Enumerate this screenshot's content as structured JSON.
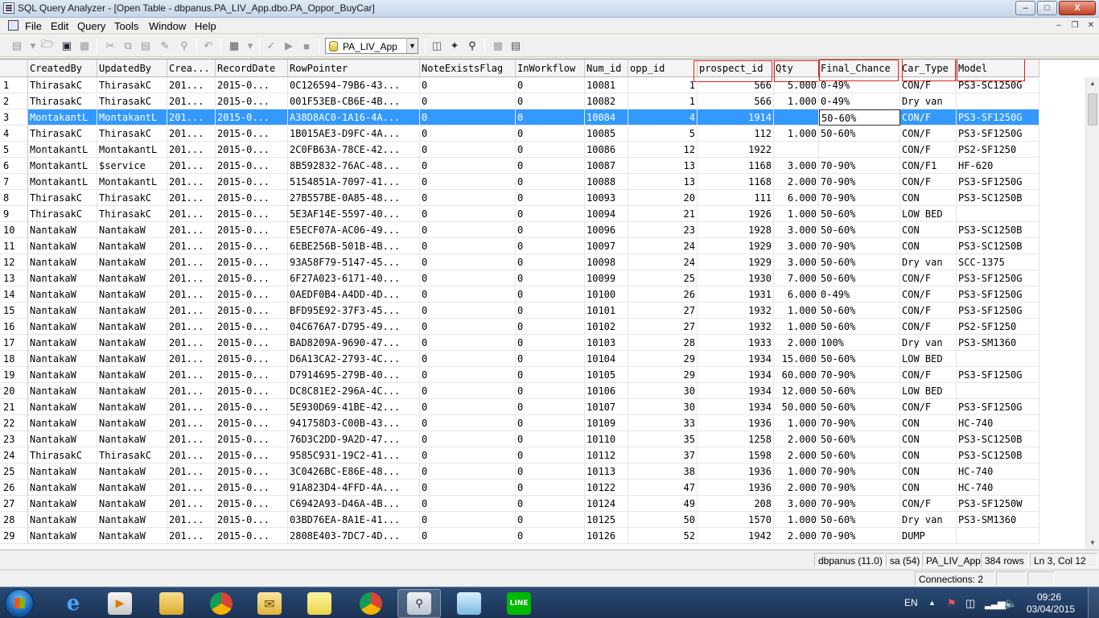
{
  "window": {
    "title": "SQL Query Analyzer - [Open Table - dbpanus.PA_LIV_App.dbo.PA_Oppor_BuyCar]",
    "minimize": "–",
    "maximize": "□",
    "close": "X"
  },
  "menu": [
    "File",
    "Edit",
    "Query",
    "Tools",
    "Window",
    "Help"
  ],
  "mdi_controls": [
    "–",
    "❐",
    "✕"
  ],
  "toolbar": {
    "database": "PA_LIV_App"
  },
  "grid": {
    "columns": [
      "CreatedBy",
      "UpdatedBy",
      "Crea...",
      "RecordDate",
      "RowPointer",
      "NoteExistsFlag",
      "InWorkflow",
      "Num_id",
      "opp_id",
      "prospect_id",
      "Qty",
      "Final_Chance",
      "Car_Type",
      "Model"
    ],
    "highlighted_columns": [
      "prospect_id",
      "Qty",
      "Final_Chance",
      "Car_Type",
      "Model"
    ],
    "selected_row": 3,
    "editing_cell": "Final_Chance",
    "rows": [
      {
        "n": "1",
        "cells": [
          "ThirasakC",
          "ThirasakC",
          "201...",
          "2015-0...",
          "0C126594-79B6-43...",
          "0",
          "0",
          "10081",
          "1",
          "566",
          "5.000",
          "0-49%",
          "CON/F",
          "PS3-SC1250G"
        ]
      },
      {
        "n": "2",
        "cells": [
          "ThirasakC",
          "ThirasakC",
          "201...",
          "2015-0...",
          "001F53EB-CB6E-4B...",
          "0",
          "0",
          "10082",
          "1",
          "566",
          "1.000",
          "0-49%",
          "Dry van",
          ""
        ]
      },
      {
        "n": "3",
        "cells": [
          "MontakantL",
          "MontakantL",
          "201...",
          "2015-0...",
          "A38D8AC0-1A16-4A...",
          "0",
          "0",
          "10084",
          "4",
          "1914",
          "",
          "50-60%",
          "CON/F",
          "PS3-SF1250G"
        ]
      },
      {
        "n": "4",
        "cells": [
          "ThirasakC",
          "ThirasakC",
          "201...",
          "2015-0...",
          "1B015AE3-D9FC-4A...",
          "0",
          "0",
          "10085",
          "5",
          "112",
          "1.000",
          "50-60%",
          "CON/F",
          "PS3-SF1250G"
        ]
      },
      {
        "n": "5",
        "cells": [
          "MontakantL",
          "MontakantL",
          "201...",
          "2015-0...",
          "2C0FB63A-78CE-42...",
          "0",
          "0",
          "10086",
          "12",
          "1922",
          "",
          "",
          "CON/F",
          "PS2-SF1250"
        ]
      },
      {
        "n": "6",
        "cells": [
          "MontakantL",
          "$service",
          "201...",
          "2015-0...",
          "8B592832-76AC-48...",
          "0",
          "0",
          "10087",
          "13",
          "1168",
          "3.000",
          "70-90%",
          "CON/F1",
          "HF-620"
        ]
      },
      {
        "n": "7",
        "cells": [
          "MontakantL",
          "MontakantL",
          "201...",
          "2015-0...",
          "5154851A-7097-41...",
          "0",
          "0",
          "10088",
          "13",
          "1168",
          "2.000",
          "70-90%",
          "CON/F",
          "PS3-SF1250G"
        ]
      },
      {
        "n": "8",
        "cells": [
          "ThirasakC",
          "ThirasakC",
          "201...",
          "2015-0...",
          "27B557BE-0A85-48...",
          "0",
          "0",
          "10093",
          "20",
          "111",
          "6.000",
          "70-90%",
          "CON",
          "PS3-SC1250B"
        ]
      },
      {
        "n": "9",
        "cells": [
          "ThirasakC",
          "ThirasakC",
          "201...",
          "2015-0...",
          "5E3AF14E-5597-40...",
          "0",
          "0",
          "10094",
          "21",
          "1926",
          "1.000",
          "50-60%",
          "LOW BED",
          ""
        ]
      },
      {
        "n": "10",
        "cells": [
          "NantakaW",
          "NantakaW",
          "201...",
          "2015-0...",
          "E5ECF07A-AC06-49...",
          "0",
          "0",
          "10096",
          "23",
          "1928",
          "3.000",
          "50-60%",
          "CON",
          "PS3-SC1250B"
        ]
      },
      {
        "n": "11",
        "cells": [
          "NantakaW",
          "NantakaW",
          "201...",
          "2015-0...",
          "6EBE256B-501B-4B...",
          "0",
          "0",
          "10097",
          "24",
          "1929",
          "3.000",
          "70-90%",
          "CON",
          "PS3-SC1250B"
        ]
      },
      {
        "n": "12",
        "cells": [
          "NantakaW",
          "NantakaW",
          "201...",
          "2015-0...",
          "93A58F79-5147-45...",
          "0",
          "0",
          "10098",
          "24",
          "1929",
          "3.000",
          "50-60%",
          "Dry van",
          "SCC-1375"
        ]
      },
      {
        "n": "13",
        "cells": [
          "NantakaW",
          "NantakaW",
          "201...",
          "2015-0...",
          "6F27A023-6171-40...",
          "0",
          "0",
          "10099",
          "25",
          "1930",
          "7.000",
          "50-60%",
          "CON/F",
          "PS3-SF1250G"
        ]
      },
      {
        "n": "14",
        "cells": [
          "NantakaW",
          "NantakaW",
          "201...",
          "2015-0...",
          "0AEDF0B4-A4DD-4D...",
          "0",
          "0",
          "10100",
          "26",
          "1931",
          "6.000",
          "0-49%",
          "CON/F",
          "PS3-SF1250G"
        ]
      },
      {
        "n": "15",
        "cells": [
          "NantakaW",
          "NantakaW",
          "201...",
          "2015-0...",
          "BFD95E92-37F3-45...",
          "0",
          "0",
          "10101",
          "27",
          "1932",
          "1.000",
          "50-60%",
          "CON/F",
          "PS3-SF1250G"
        ]
      },
      {
        "n": "16",
        "cells": [
          "NantakaW",
          "NantakaW",
          "201...",
          "2015-0...",
          "04C676A7-D795-49...",
          "0",
          "0",
          "10102",
          "27",
          "1932",
          "1.000",
          "50-60%",
          "CON/F",
          "PS2-SF1250"
        ]
      },
      {
        "n": "17",
        "cells": [
          "NantakaW",
          "NantakaW",
          "201...",
          "2015-0...",
          "BAD8209A-9690-47...",
          "0",
          "0",
          "10103",
          "28",
          "1933",
          "2.000",
          "100%",
          "Dry van",
          "PS3-SM1360"
        ]
      },
      {
        "n": "18",
        "cells": [
          "NantakaW",
          "NantakaW",
          "201...",
          "2015-0...",
          "D6A13CA2-2793-4C...",
          "0",
          "0",
          "10104",
          "29",
          "1934",
          "15.000",
          "50-60%",
          "LOW BED",
          ""
        ]
      },
      {
        "n": "19",
        "cells": [
          "NantakaW",
          "NantakaW",
          "201...",
          "2015-0...",
          "D7914695-279B-40...",
          "0",
          "0",
          "10105",
          "29",
          "1934",
          "60.000",
          "70-90%",
          "CON/F",
          "PS3-SF1250G"
        ]
      },
      {
        "n": "20",
        "cells": [
          "NantakaW",
          "NantakaW",
          "201...",
          "2015-0...",
          "DC8C81E2-296A-4C...",
          "0",
          "0",
          "10106",
          "30",
          "1934",
          "12.000",
          "50-60%",
          "LOW BED",
          ""
        ]
      },
      {
        "n": "21",
        "cells": [
          "NantakaW",
          "NantakaW",
          "201...",
          "2015-0...",
          "5E930D69-41BE-42...",
          "0",
          "0",
          "10107",
          "30",
          "1934",
          "50.000",
          "50-60%",
          "CON/F",
          "PS3-SF1250G"
        ]
      },
      {
        "n": "22",
        "cells": [
          "NantakaW",
          "NantakaW",
          "201...",
          "2015-0...",
          "941758D3-C00B-43...",
          "0",
          "0",
          "10109",
          "33",
          "1936",
          "1.000",
          "70-90%",
          "CON",
          "HC-740"
        ]
      },
      {
        "n": "23",
        "cells": [
          "NantakaW",
          "NantakaW",
          "201...",
          "2015-0...",
          "76D3C2DD-9A2D-47...",
          "0",
          "0",
          "10110",
          "35",
          "1258",
          "2.000",
          "50-60%",
          "CON",
          "PS3-SC1250B"
        ]
      },
      {
        "n": "24",
        "cells": [
          "ThirasakC",
          "ThirasakC",
          "201...",
          "2015-0...",
          "9585C931-19C2-41...",
          "0",
          "0",
          "10112",
          "37",
          "1598",
          "2.000",
          "50-60%",
          "CON",
          "PS3-SC1250B"
        ]
      },
      {
        "n": "25",
        "cells": [
          "NantakaW",
          "NantakaW",
          "201...",
          "2015-0...",
          "3C0426BC-E86E-48...",
          "0",
          "0",
          "10113",
          "38",
          "1936",
          "1.000",
          "70-90%",
          "CON",
          "HC-740"
        ]
      },
      {
        "n": "26",
        "cells": [
          "NantakaW",
          "NantakaW",
          "201...",
          "2015-0...",
          "91A823D4-4FFD-4A...",
          "0",
          "0",
          "10122",
          "47",
          "1936",
          "2.000",
          "70-90%",
          "CON",
          "HC-740"
        ]
      },
      {
        "n": "27",
        "cells": [
          "NantakaW",
          "NantakaW",
          "201...",
          "2015-0...",
          "C6942A93-D46A-4B...",
          "0",
          "0",
          "10124",
          "49",
          "208",
          "3.000",
          "70-90%",
          "CON/F",
          "PS3-SF1250W"
        ]
      },
      {
        "n": "28",
        "cells": [
          "NantakaW",
          "NantakaW",
          "201...",
          "2015-0...",
          "03BD76EA-8A1E-41...",
          "0",
          "0",
          "10125",
          "50",
          "1570",
          "1.000",
          "50-60%",
          "Dry van",
          "PS3-SM1360"
        ]
      },
      {
        "n": "29",
        "cells": [
          "NantakaW",
          "NantakaW",
          "201...",
          "2015-0...",
          "2808E403-7DC7-4D...",
          "0",
          "0",
          "10126",
          "52",
          "1942",
          "2.000",
          "70-90%",
          "DUMP",
          ""
        ]
      }
    ]
  },
  "status": {
    "server": "dbpanus (11.0)",
    "user": "sa (54)",
    "database": "PA_LIV_App",
    "rows": "384 rows",
    "position": "Ln 3, Col 12",
    "connections": "Connections: 2"
  },
  "taskbar": {
    "language": "EN",
    "time": "09:26",
    "date": "03/04/2015",
    "line_label": "LINE"
  },
  "colors": {
    "selection": "#3399ff",
    "annotation": "#e02020",
    "taskbar": "#1b3356"
  }
}
